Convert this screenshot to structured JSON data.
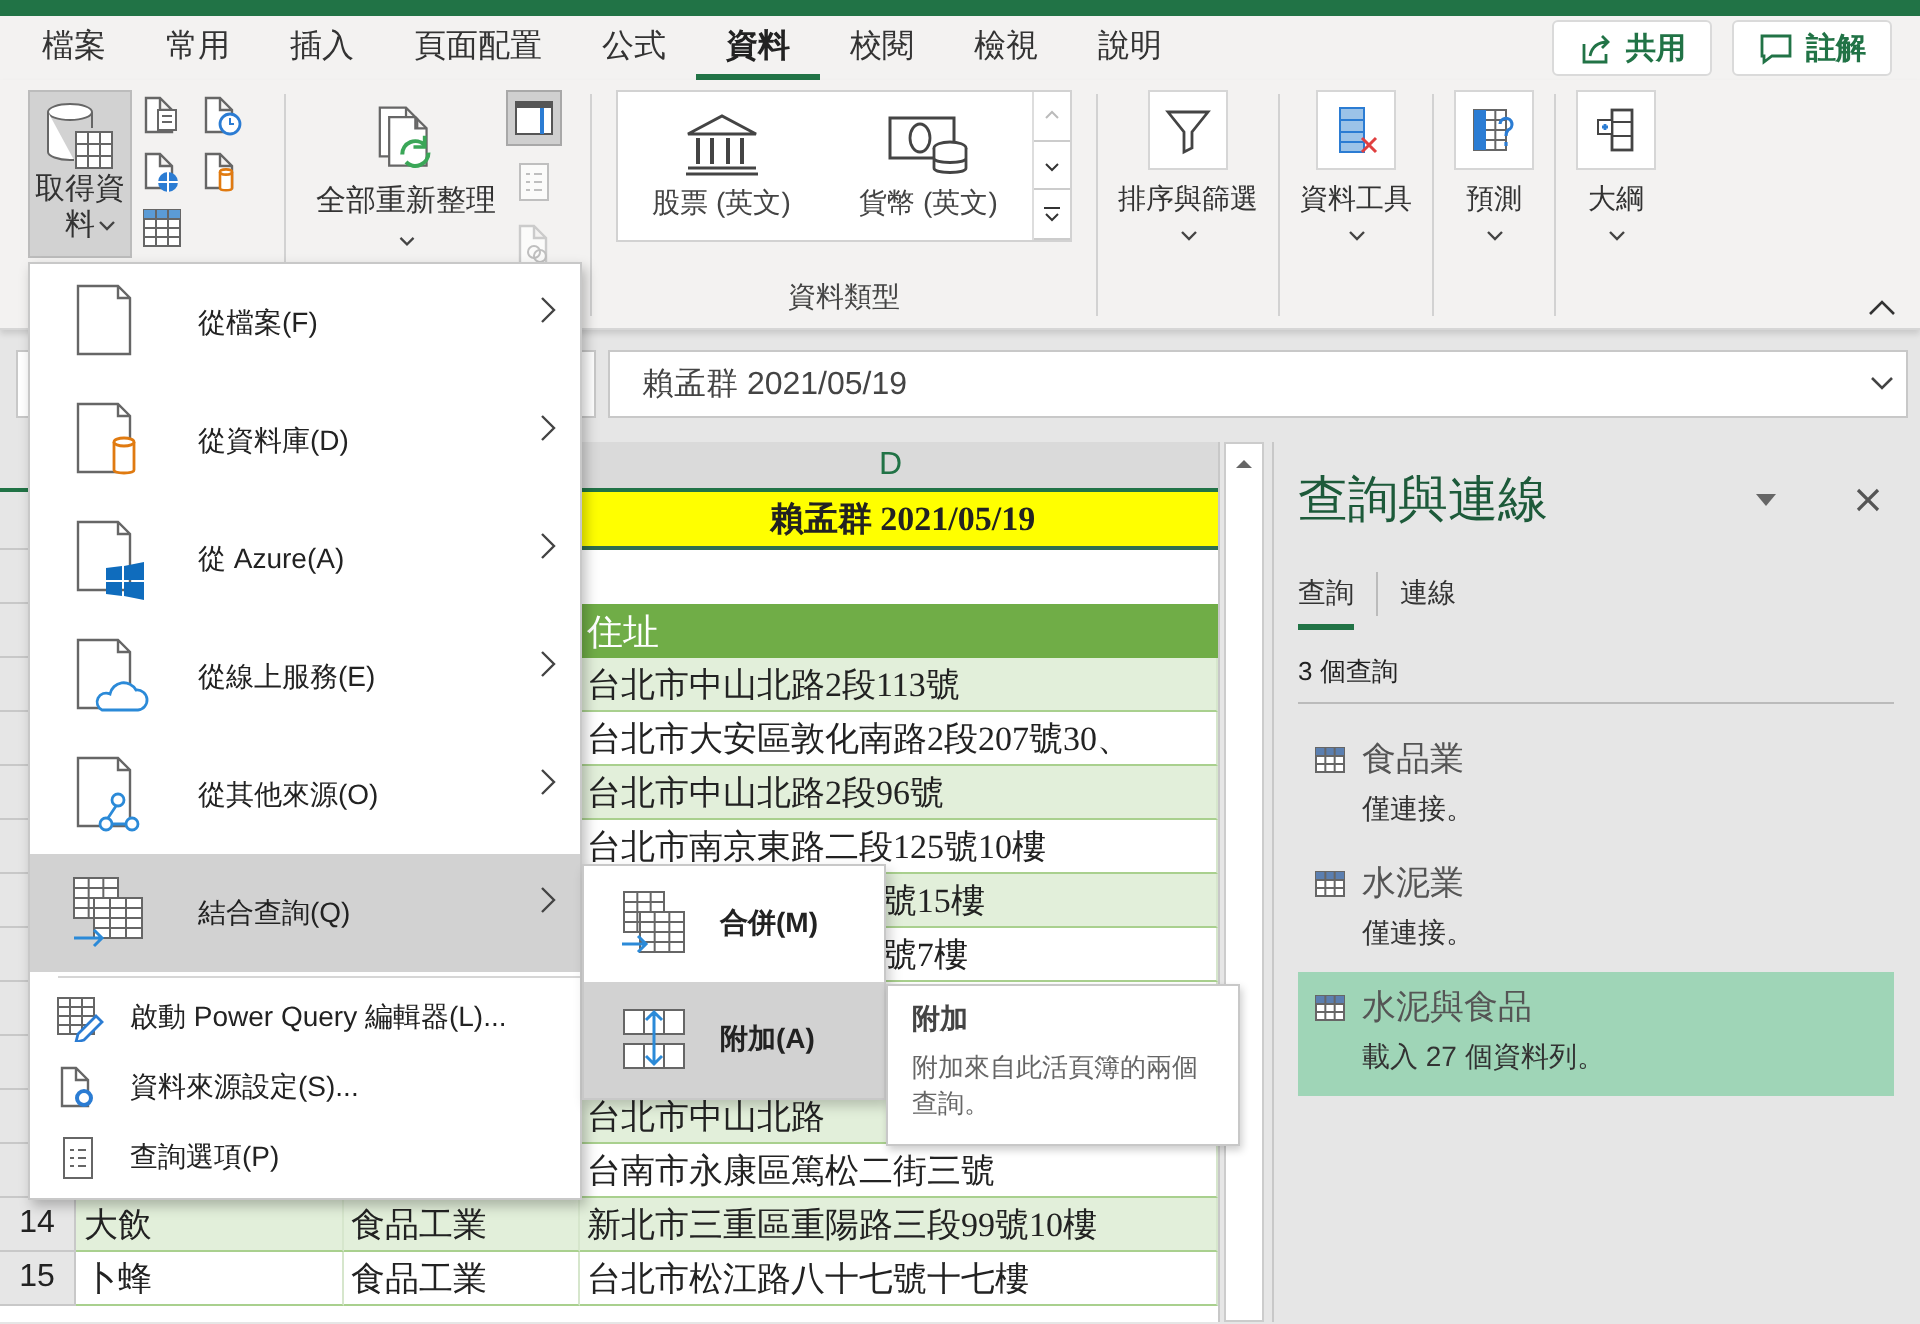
{
  "tabs": [
    {
      "label": "檔案",
      "selected": false
    },
    {
      "label": "常用",
      "selected": false
    },
    {
      "label": "插入",
      "selected": false
    },
    {
      "label": "頁面配置",
      "selected": false
    },
    {
      "label": "公式",
      "selected": false
    },
    {
      "label": "資料",
      "selected": true
    },
    {
      "label": "校閱",
      "selected": false
    },
    {
      "label": "檢視",
      "selected": false
    },
    {
      "label": "說明",
      "selected": false
    }
  ],
  "header_buttons": [
    {
      "kind": "share",
      "label": "共用"
    },
    {
      "kind": "comment",
      "label": "註解"
    }
  ],
  "ribbon": {
    "get_data": {
      "label": "取得資料",
      "pressed": true
    },
    "small_icons": [
      {
        "kind": "text-file"
      },
      {
        "kind": "clock-file"
      },
      {
        "kind": "web-file"
      },
      {
        "kind": "database-file"
      },
      {
        "kind": "table"
      }
    ],
    "refresh": {
      "label": "全部重新整理"
    },
    "side_icons": [
      {
        "kind": "pane",
        "pressed": true,
        "disabled": false
      },
      {
        "kind": "properties",
        "pressed": false,
        "disabled": true
      },
      {
        "kind": "links",
        "pressed": false,
        "disabled": true
      }
    ],
    "data_types": {
      "label": "資料類型",
      "items": [
        {
          "kind": "bank",
          "label": "股票 (英文)"
        },
        {
          "kind": "currency",
          "label": "貨幣 (英文)"
        }
      ]
    },
    "groups": [
      {
        "kind": "filter",
        "label": "排序與篩選"
      },
      {
        "kind": "tools",
        "label": "資料工具"
      },
      {
        "kind": "forecast",
        "label": "預測"
      },
      {
        "kind": "outline",
        "label": "大綱"
      }
    ]
  },
  "formula_bar": {
    "value": "賴孟群 2021/05/19"
  },
  "sheet": {
    "column_headers": {
      "col_d": "D"
    },
    "rows": [
      {
        "kind": "title",
        "col_d": "賴孟群 2021/05/19"
      },
      {
        "kind": "blank"
      },
      {
        "kind": "header",
        "col_d": "住址"
      },
      {
        "kind": "data",
        "shaded": true,
        "col_d": "台北市中山北路2段113號"
      },
      {
        "kind": "data",
        "shaded": false,
        "col_d": "台北市大安區敦化南路2段207號30、"
      },
      {
        "kind": "data",
        "shaded": true,
        "col_d": "台北市中山北路2段96號"
      },
      {
        "kind": "data",
        "shaded": false,
        "col_d": "台北市南京東路二段125號10樓"
      },
      {
        "kind": "data",
        "shaded": true,
        "col_d": "號15樓",
        "clipped": true
      },
      {
        "kind": "data",
        "shaded": false,
        "col_d": "號7樓",
        "clipped": true
      },
      {
        "kind": "data"
      },
      {
        "kind": "data"
      },
      {
        "kind": "data",
        "shaded": true,
        "col_d": "台北市中山北路"
      },
      {
        "kind": "data",
        "shaded": false,
        "col_d": "台南市永康區篤松二街三號"
      },
      {
        "kind": "data",
        "shaded": true,
        "number": "14",
        "col_b": "大飲",
        "col_c": "食品工業",
        "col_d": "新北市三重區重陽路三段99號10樓"
      },
      {
        "kind": "data",
        "shaded": false,
        "number": "15",
        "col_b": "卜蜂",
        "col_c": "食品工業",
        "col_d": "台北市松江路八十七號十七樓"
      }
    ]
  },
  "menu": {
    "items": [
      {
        "kind": "file",
        "label": "從檔案(F)",
        "submenu": true,
        "selected": false
      },
      {
        "kind": "database",
        "label": "從資料庫(D)",
        "submenu": true,
        "selected": false
      },
      {
        "kind": "azure",
        "label": "從 Azure(A)",
        "submenu": true,
        "selected": false
      },
      {
        "kind": "online",
        "label": "從線上服務(E)",
        "submenu": true,
        "selected": false
      },
      {
        "kind": "other",
        "label": "從其他來源(O)",
        "submenu": true,
        "selected": false
      },
      {
        "kind": "combine",
        "label": "結合查詢(Q)",
        "submenu": true,
        "selected": true
      },
      {
        "kind": "editor",
        "label": "啟動 Power Query 編輯器(L)...",
        "submenu": false,
        "selected": false
      },
      {
        "kind": "settings",
        "label": "資料來源設定(S)...",
        "submenu": false,
        "selected": false
      },
      {
        "kind": "options",
        "label": "查詢選項(P)",
        "submenu": false,
        "selected": false
      }
    ]
  },
  "submenu": {
    "items": [
      {
        "kind": "merge",
        "label": "合併(M)",
        "selected": false
      },
      {
        "kind": "append",
        "label": "附加(A)",
        "selected": true
      }
    ]
  },
  "tooltip": {
    "title": "附加",
    "text": "附加來自此活頁簿的兩個查詢。"
  },
  "pane": {
    "title": "查詢與連線",
    "tabs": [
      {
        "label": "查詢",
        "selected": true
      },
      {
        "label": "連線",
        "selected": false
      }
    ],
    "count": "3 個查詢",
    "queries": [
      {
        "name": "食品業",
        "status": "僅連接。",
        "selected": false
      },
      {
        "name": "水泥業",
        "status": "僅連接。",
        "selected": false
      },
      {
        "name": "水泥與食品",
        "status": "載入 27 個資料列。",
        "selected": true
      }
    ]
  }
}
